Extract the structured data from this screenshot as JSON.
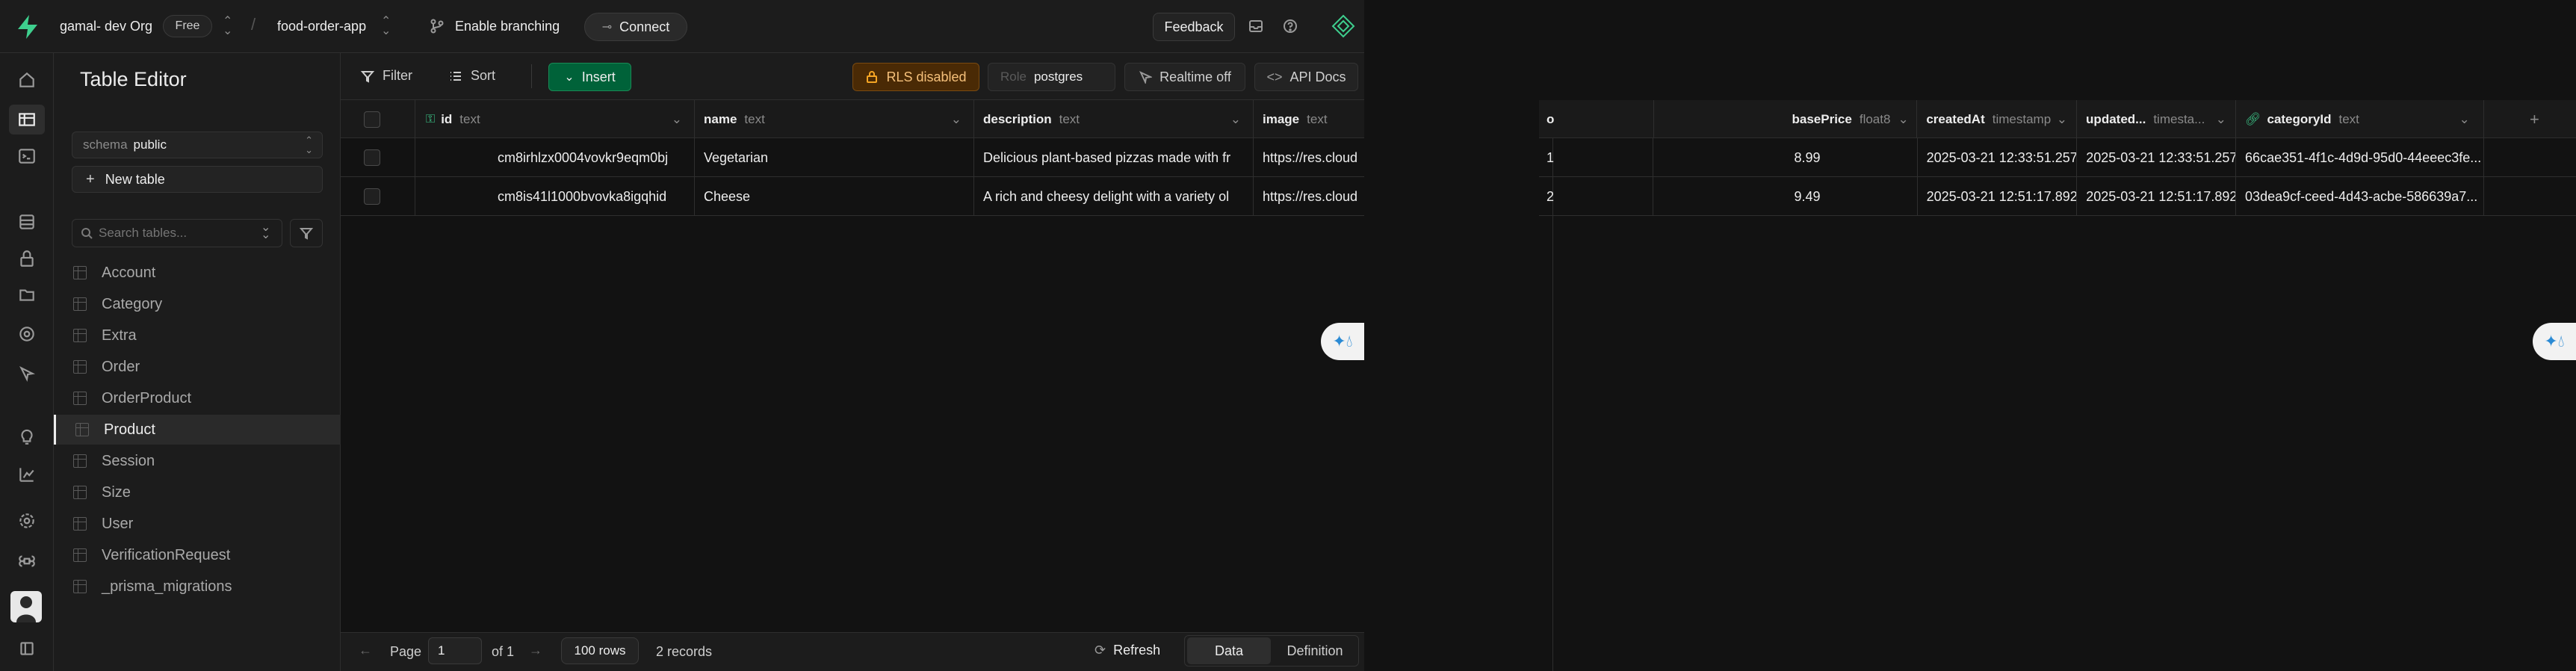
{
  "topbar": {
    "org": "gamal- dev Org",
    "plan": "Free",
    "project": "food-order-app",
    "branching": "Enable branching",
    "connect": "Connect",
    "feedback": "Feedback"
  },
  "sidebar": {
    "title": "Table Editor",
    "schema_label": "schema",
    "schema_value": "public",
    "new_table": "New table",
    "search_placeholder": "Search tables...",
    "tables": [
      "Account",
      "Category",
      "Extra",
      "Order",
      "OrderProduct",
      "Product",
      "Session",
      "Size",
      "User",
      "VerificationRequest",
      "_prisma_migrations"
    ],
    "active": "Product"
  },
  "toolbar": {
    "filter": "Filter",
    "sort": "Sort",
    "insert": "Insert",
    "rls": "RLS disabled",
    "role_label": "Role",
    "role_value": "postgres",
    "realtime": "Realtime off",
    "api_docs": "API Docs"
  },
  "grid": {
    "headers": [
      {
        "name": "id",
        "type": "text"
      },
      {
        "name": "name",
        "type": "text"
      },
      {
        "name": "description",
        "type": "text"
      },
      {
        "name": "image",
        "type": "text"
      },
      {
        "name": "o",
        "type": ""
      },
      {
        "name": "basePrice",
        "type": "float8"
      },
      {
        "name": "createdAt",
        "type": "timestamp"
      },
      {
        "name": "updated...",
        "type": "timesta..."
      },
      {
        "name": "categoryId",
        "type": "text"
      }
    ],
    "rows": [
      {
        "id": "cm8irhlzx0004vovkr9eqm0bj",
        "name": "Vegetarian",
        "description": "Delicious plant-based pizzas made with fr",
        "image": "https://res.cloud",
        "o": "1",
        "basePrice": "8.99",
        "createdAt": "2025-03-21 12:33:51.257",
        "updatedAt": "2025-03-21 12:33:51.257",
        "categoryId": "66cae351-4f1c-4d9d-95d0-44eeec3fe..."
      },
      {
        "id": "cm8is41l1000bvovka8igqhid",
        "name": "Cheese",
        "description": "A rich and cheesy delight with a variety ol",
        "image": "https://res.cloud",
        "o": "2",
        "basePrice": "9.49",
        "createdAt": "2025-03-21 12:51:17.892",
        "updatedAt": "2025-03-21 12:51:17.892",
        "categoryId": "03dea9cf-ceed-4d43-acbe-586639a7..."
      }
    ],
    "add_column": "+"
  },
  "footer": {
    "page_label": "Page",
    "page_value": "1",
    "of": "of 1",
    "rows_per_page": "100 rows",
    "records": "2 records",
    "refresh": "Refresh",
    "data_tab": "Data",
    "definition_tab": "Definition"
  },
  "colors": {
    "brand": "#3ecf8e",
    "insert_bg": "#006239",
    "rls_bg": "#4a2a05",
    "rls_text": "#f5a524"
  }
}
